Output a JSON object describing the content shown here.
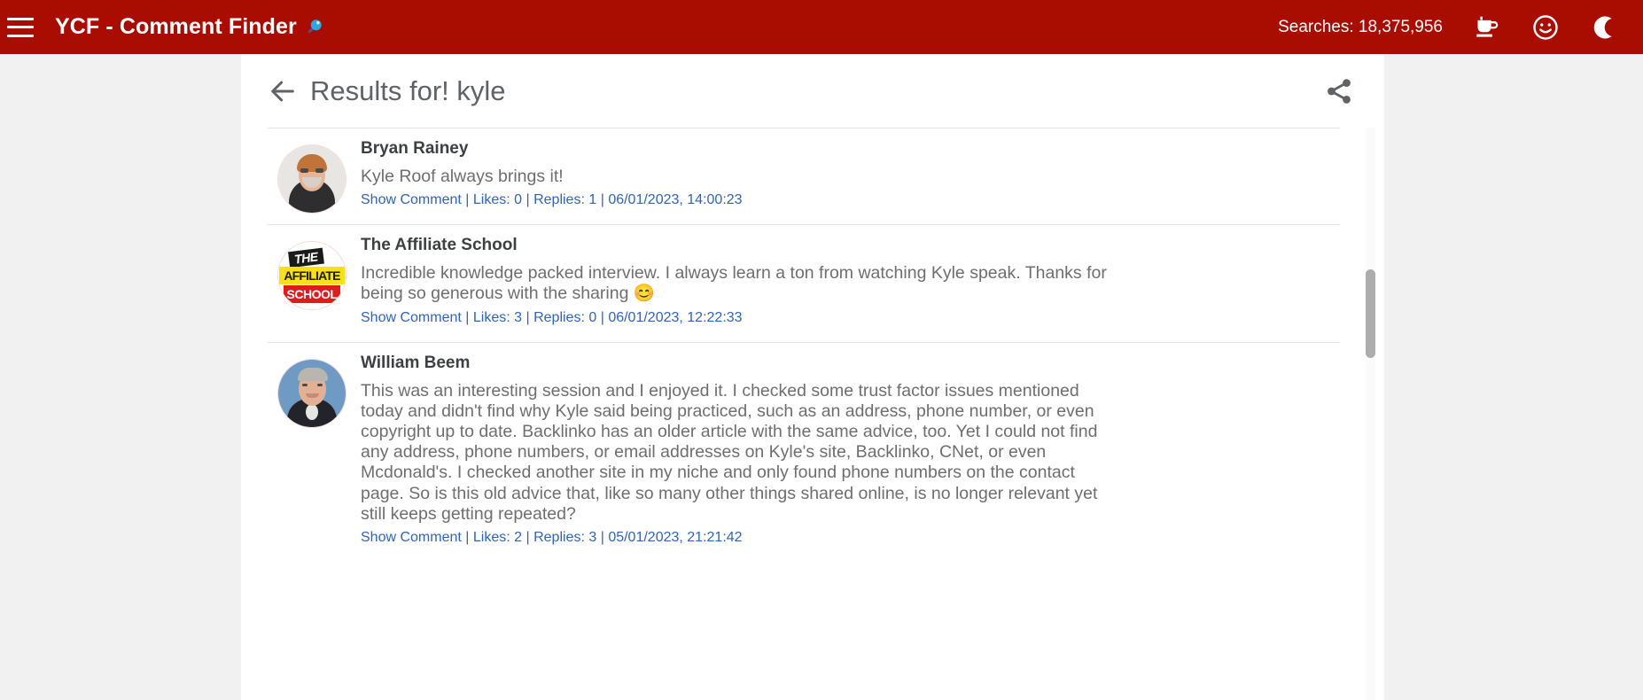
{
  "appbar": {
    "menu_icon": "hamburger-menu-icon",
    "title": "YCF - Comment Finder",
    "title_emoji": "magnifier-icon",
    "searches_label": "Searches: 18,375,956",
    "icons": [
      {
        "name": "coffee-cup-icon",
        "glyph": "☕"
      },
      {
        "name": "smiley-face-icon",
        "glyph": "☺"
      },
      {
        "name": "dark-mode-moon-icon",
        "glyph": "☾"
      }
    ],
    "background_color": "#a90d02",
    "text_color": "#ffffff"
  },
  "page": {
    "back_icon": "back-arrow-icon",
    "title": "Results for! kyle",
    "share_icon": "share-icon"
  },
  "results": [
    {
      "author": "Bryan Rainey",
      "avatar_type": "photo-portrait",
      "text": "Kyle Roof always brings it!",
      "show_comment": "Show Comment",
      "likes": "Likes: 0",
      "replies": "Replies: 1",
      "timestamp": "06/01/2023, 14:00:23"
    },
    {
      "author": "The Affiliate School",
      "avatar_type": "logo",
      "avatar_logo_lines": [
        "THE",
        "AFFILIATE",
        "SCHOOL"
      ],
      "text": "Incredible knowledge packed interview. I always learn a ton from watching Kyle speak. Thanks for being so generous with the sharing 😊",
      "show_comment": "Show Comment",
      "likes": "Likes: 3",
      "replies": "Replies: 0",
      "timestamp": "06/01/2023, 12:22:33"
    },
    {
      "author": "William Beem",
      "avatar_type": "photo-portrait",
      "text": "This was an interesting session and I enjoyed it. I checked some trust factor issues mentioned today and didn't find why Kyle said being practiced, such as an address, phone number, or even copyright up to date. Backlinko has an older article with the same advice, too. Yet I could not find any address, phone numbers, or email addresses on Kyle's site, Backlinko, CNet, or even Mcdonald's. I checked another site in my niche and only found phone numbers on the contact page. So is this old advice that, like so many other things shared online, is no longer relevant yet still keeps getting repeated?",
      "show_comment": "Show Comment",
      "likes": "Likes: 2",
      "replies": "Replies: 3",
      "timestamp": "05/01/2023, 21:21:42"
    }
  ],
  "separator": "|",
  "colors": {
    "brand_red": "#a90d02",
    "link_blue": "#3063b8",
    "body_text": "#6e6e6e",
    "author_text": "#3c4043",
    "title_text": "#5f6368",
    "page_bg": "#f1f1f1"
  }
}
